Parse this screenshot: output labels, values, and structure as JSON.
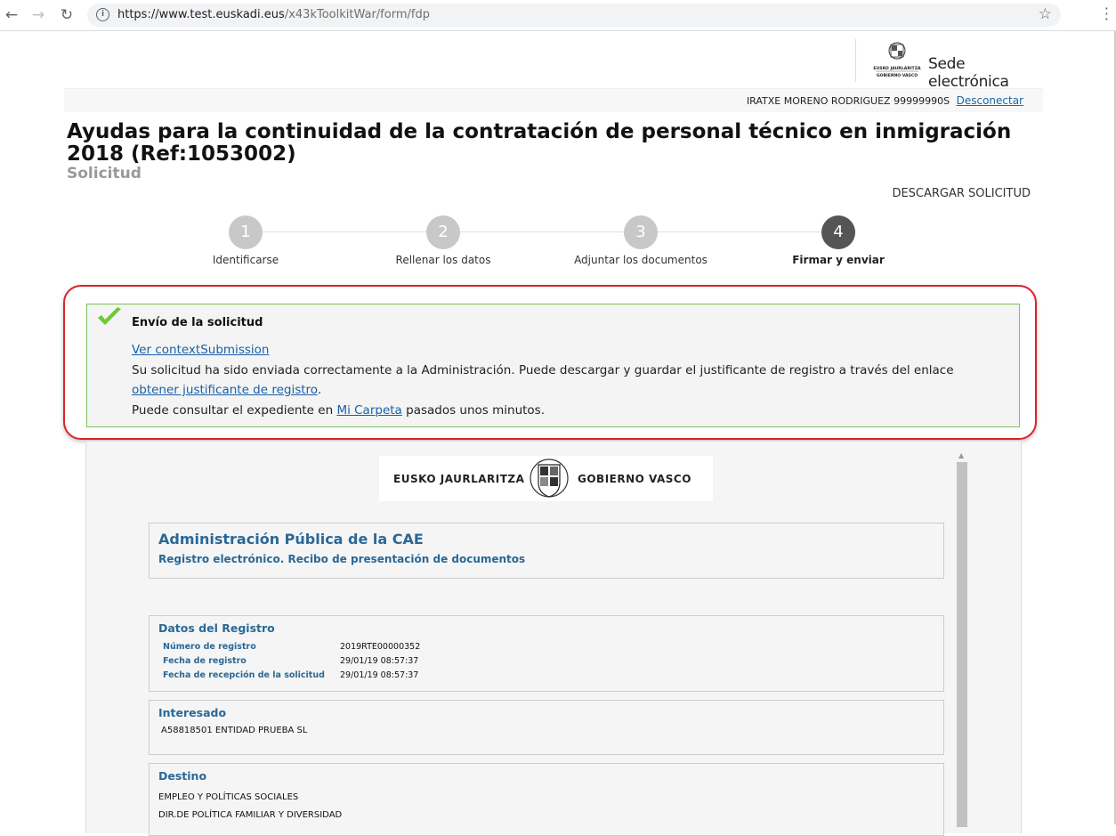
{
  "browser": {
    "url_host": "https://www.test.euskadi.eus",
    "url_path": "/x43kToolkitWar/form/fdp"
  },
  "header": {
    "sede_label": "Sede electrónica",
    "logo_text_top": "EUSKO JAURLARITZA",
    "logo_text_bottom": "GOBIERNO VASCO",
    "user_name": "IRATXE MORENO RODRIGUEZ",
    "user_id": "99999990S",
    "logout_label": "Desconectar"
  },
  "page": {
    "title": "Ayudas para la continuidad de la contratación de personal técnico en inmigración 2018 (Ref:1053002)",
    "subtitle": "Solicitud",
    "download_label": "DESCARGAR SOLICITUD"
  },
  "steps": [
    {
      "num": "1",
      "label": "Identificarse"
    },
    {
      "num": "2",
      "label": "Rellenar los datos"
    },
    {
      "num": "3",
      "label": "Adjuntar los documentos"
    },
    {
      "num": "4",
      "label": "Firmar y enviar"
    }
  ],
  "success": {
    "title": "Envío de la solicitud",
    "view_link": "Ver contextSubmission",
    "text1": "Su solicitud ha sido enviada correctamente a la Administración. Puede descargar y guardar el justificante de registro a través del enlace ",
    "justificante_link": "obtener justificante de registro",
    "text1_end": ".",
    "text2": "Puede consultar el expediente en ",
    "carpeta_link": "Mi Carpeta",
    "text2_end": " pasados unos minutos."
  },
  "document": {
    "logo_left": "EUSKO JAURLARITZA",
    "logo_right": "GOBIERNO VASCO",
    "admin_title": "Administración Pública de la CAE",
    "admin_subtitle": "Registro electrónico. Recibo de presentación de documentos",
    "registro_title": "Datos del Registro",
    "registro_rows": [
      {
        "label": "Número de registro",
        "value": "2019RTE00000352"
      },
      {
        "label": "Fecha de registro",
        "value": "29/01/19 08:57:37"
      },
      {
        "label": "Fecha de recepción de la solicitud",
        "value": "29/01/19 08:57:37"
      }
    ],
    "interesado_title": "Interesado",
    "interesado_value": "A58818501 ENTIDAD PRUEBA SL",
    "destino_title": "Destino",
    "destino_line1": "EMPLEO Y POLÍTICAS SOCIALES",
    "destino_line2": "DIR.DE POLÍTICA FAMILIAR Y DIVERSIDAD"
  }
}
